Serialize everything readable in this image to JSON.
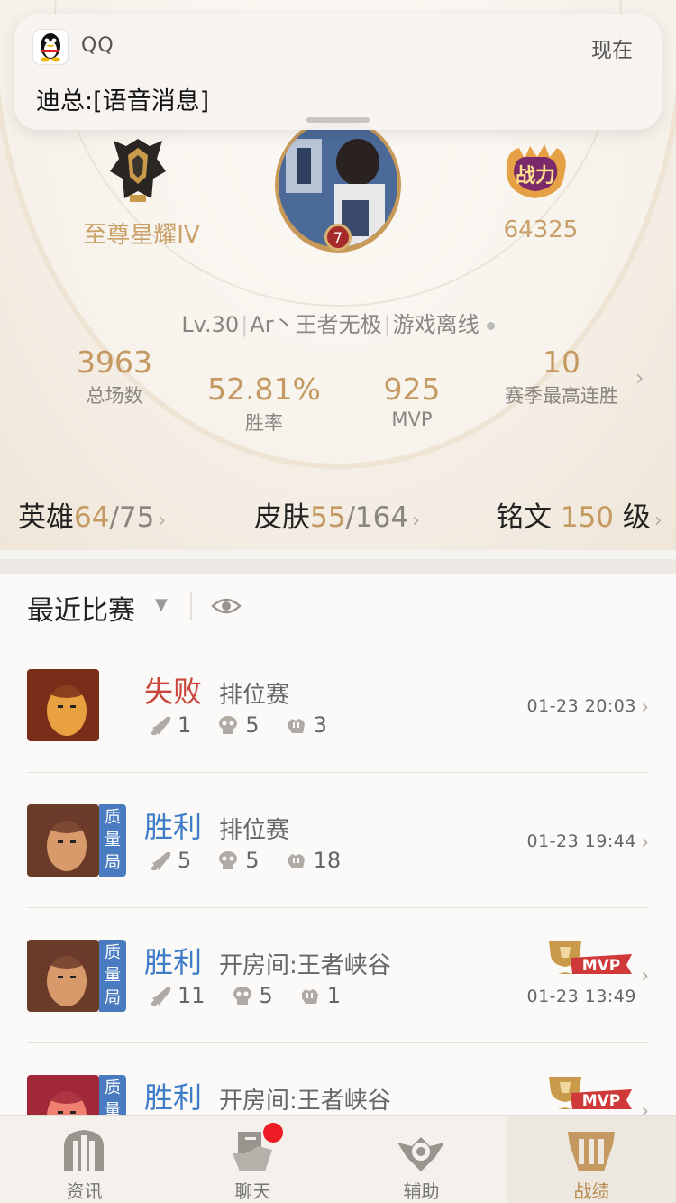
{
  "notification": {
    "app_name": "QQ",
    "time": "现在",
    "message": "迪总:[语音消息]"
  },
  "profile": {
    "rank_name": "至尊星耀IV",
    "avatar_level": "7",
    "battle_power": "64325",
    "level_text": "Lv.30",
    "player_name": "Ar丶王者无极",
    "status": "游戏离线"
  },
  "stats": {
    "total_matches": {
      "value": "3963",
      "label": "总场数"
    },
    "win_rate": {
      "value": "52.81%",
      "label": "胜率"
    },
    "mvp": {
      "value": "925",
      "label": "MVP"
    },
    "best_streak": {
      "value": "10",
      "label": "赛季最高连胜"
    }
  },
  "collection": {
    "heroes": {
      "label": "英雄",
      "owned": "64",
      "total": "/75"
    },
    "skins": {
      "label": "皮肤",
      "owned": "55",
      "total": "/164"
    },
    "inscription": {
      "label": "铭文",
      "level": "150",
      "unit": "级"
    }
  },
  "recent": {
    "title": "最近比赛"
  },
  "matches": [
    {
      "result": "失败",
      "result_type": "lose",
      "mode": "排位赛",
      "kills": "1",
      "deaths": "5",
      "assists": "3",
      "time": "01-23 20:03",
      "quality_tag": "",
      "mvp": false,
      "hero_colors": [
        "#7a2e1a",
        "#e8a040"
      ]
    },
    {
      "result": "胜利",
      "result_type": "win",
      "mode": "排位赛",
      "kills": "5",
      "deaths": "5",
      "assists": "18",
      "time": "01-23 19:44",
      "quality_tag": "质量局",
      "mvp": false,
      "hero_colors": [
        "#6b3b2a",
        "#d89a6a"
      ]
    },
    {
      "result": "胜利",
      "result_type": "win",
      "mode": "开房间:王者峡谷",
      "kills": "11",
      "deaths": "5",
      "assists": "1",
      "time": "01-23 13:49",
      "quality_tag": "质量局",
      "mvp": true,
      "hero_colors": [
        "#6b3b2a",
        "#d89a6a"
      ]
    },
    {
      "result": "胜利",
      "result_type": "win",
      "mode": "开房间:王者峡谷",
      "kills": "",
      "deaths": "",
      "assists": "",
      "time": "",
      "quality_tag": "质量局",
      "mvp": true,
      "hero_colors": [
        "#a02838",
        "#f08070"
      ]
    }
  ],
  "mvp_badge_text": "MVP",
  "quality_chars": [
    "质",
    "量",
    "局"
  ],
  "tabs": [
    {
      "label": "资讯",
      "icon": "news-icon",
      "active": false,
      "badge": false
    },
    {
      "label": "聊天",
      "icon": "chat-icon",
      "active": false,
      "badge": true
    },
    {
      "label": "辅助",
      "icon": "assist-icon",
      "active": false,
      "badge": false
    },
    {
      "label": "战绩",
      "icon": "record-icon",
      "active": true,
      "badge": false
    }
  ],
  "colors": {
    "gold": "#c49a62",
    "lose": "#c9453a",
    "win": "#3f7cc9",
    "quality_tag": "#4a7bc0",
    "notification_badge": "#ee1c24"
  }
}
